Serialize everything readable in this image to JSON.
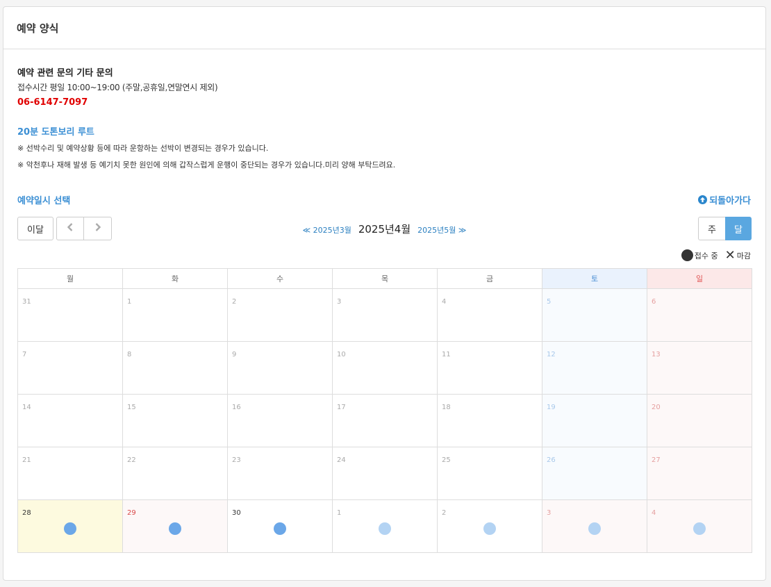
{
  "header": {
    "title": "예약 양식"
  },
  "info": {
    "heading": "예약 관련 문의 기타 문의",
    "hours": "접수시간 평일 10:00~19:00 (주말,공휴일,연말연시 제외)",
    "phone": "06-6147-7097"
  },
  "route": {
    "title": "20분 도톤보리 루트",
    "notes": [
      "※ 선박수리 및 예약상황 등에 따라 운항하는 선박이 변경되는 경우가 있습니다.",
      "※ 악천후나 재해 발생 등 예기치 못한 원인에 의해 갑작스럽게 운행이 중단되는 경우가 있습니다.미리 양해 부탁드려요."
    ]
  },
  "booking": {
    "select_title": "예약일시 선택",
    "back_label": "되돌아가다",
    "today_label": "이달",
    "prev_month": "≪ 2025년3월",
    "current_month": "2025년4월",
    "next_month": "2025년5월 ≫",
    "week_label": "주",
    "month_label": "달",
    "legend_open": "접수 중",
    "legend_closed": "마감"
  },
  "calendar": {
    "weekdays": [
      "월",
      "화",
      "수",
      "목",
      "금",
      "토",
      "일"
    ],
    "weeks": [
      [
        "31",
        "1",
        "2",
        "3",
        "4",
        "5",
        "6"
      ],
      [
        "7",
        "8",
        "9",
        "10",
        "11",
        "12",
        "13"
      ],
      [
        "14",
        "15",
        "16",
        "17",
        "18",
        "19",
        "20"
      ],
      [
        "21",
        "22",
        "23",
        "24",
        "25",
        "26",
        "27"
      ],
      [
        "28",
        "29",
        "30",
        "1",
        "2",
        "3",
        "4"
      ]
    ]
  },
  "colors": {
    "accent": "#3b8fd4",
    "phone": "#e00000",
    "available": "#6ba7e8",
    "available_light": "#b3d3f3",
    "today": "#fdfadf"
  }
}
